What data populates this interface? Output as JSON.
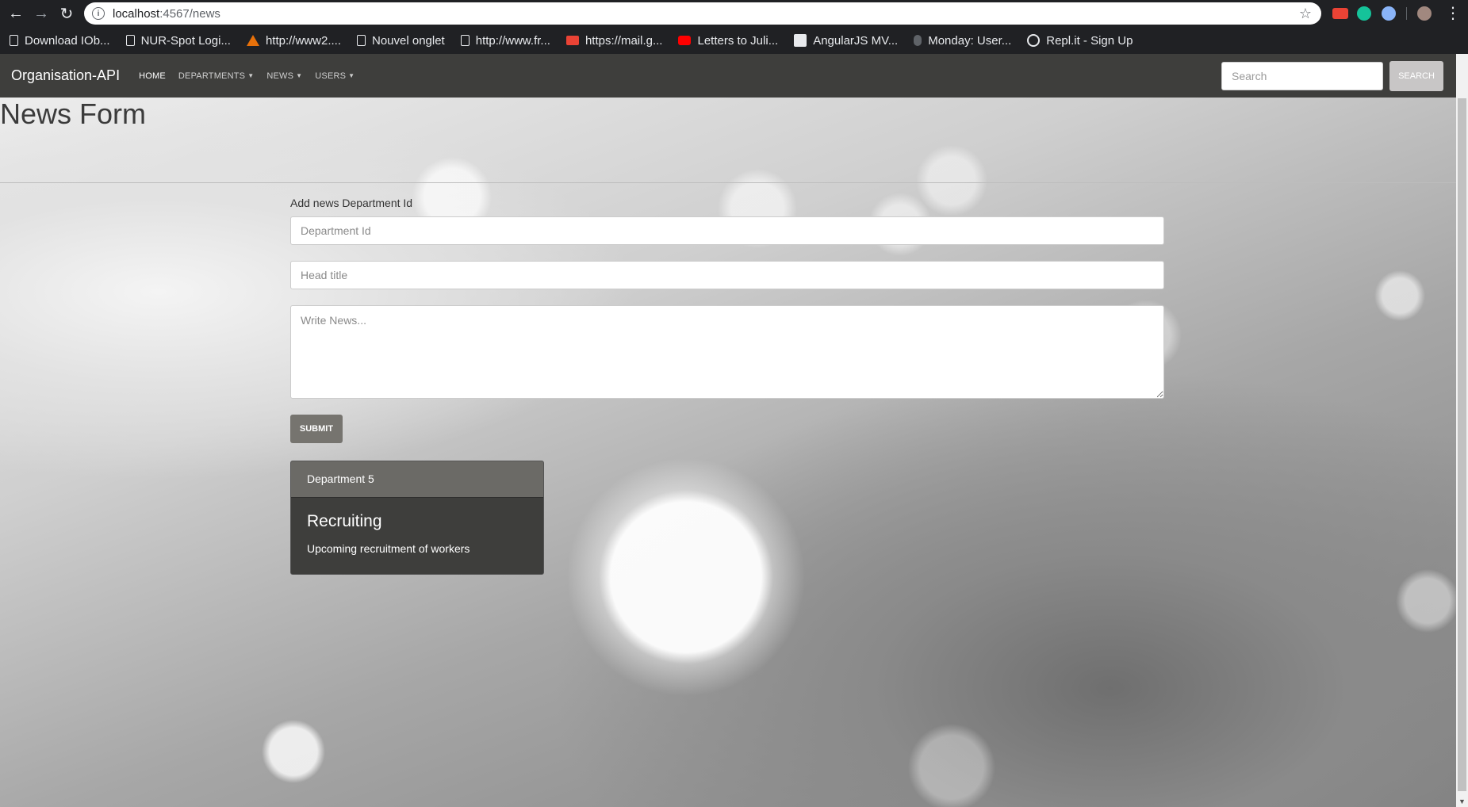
{
  "browser": {
    "url_host": "localhost",
    "url_path": ":4567/news",
    "bookmarks": [
      {
        "label": "Download IOb...",
        "icon": "page-icon"
      },
      {
        "label": "NUR-Spot Logi...",
        "icon": "page-icon"
      },
      {
        "label": "http://www2....",
        "icon": "triangle-icon"
      },
      {
        "label": "Nouvel onglet",
        "icon": "page-icon"
      },
      {
        "label": "http://www.fr...",
        "icon": "page-icon"
      },
      {
        "label": "https://mail.g...",
        "icon": "mail-icon"
      },
      {
        "label": "Letters to Juli...",
        "icon": "youtube-icon"
      },
      {
        "label": "AngularJS MV...",
        "icon": "angular-icon"
      },
      {
        "label": "Monday: User...",
        "icon": "monday-icon"
      },
      {
        "label": "Repl.it - Sign Up",
        "icon": "repl-icon"
      }
    ]
  },
  "navbar": {
    "brand": "Organisation-API",
    "links": [
      {
        "label": "HOME",
        "active": true
      },
      {
        "label": "DEPARTMENTS",
        "dropdown": true
      },
      {
        "label": "NEWS",
        "dropdown": true
      },
      {
        "label": "USERS",
        "dropdown": true
      }
    ],
    "search_placeholder": "Search",
    "search_button": "SEARCH"
  },
  "page": {
    "title": "News Form"
  },
  "form": {
    "label": "Add news Department Id",
    "department_placeholder": "Department Id",
    "head_title_placeholder": "Head title",
    "news_placeholder": "Write News...",
    "submit_label": "SUBMIT"
  },
  "news_card": {
    "header": "Department 5",
    "title": "Recruiting",
    "text": "Upcoming recruitment of workers"
  }
}
